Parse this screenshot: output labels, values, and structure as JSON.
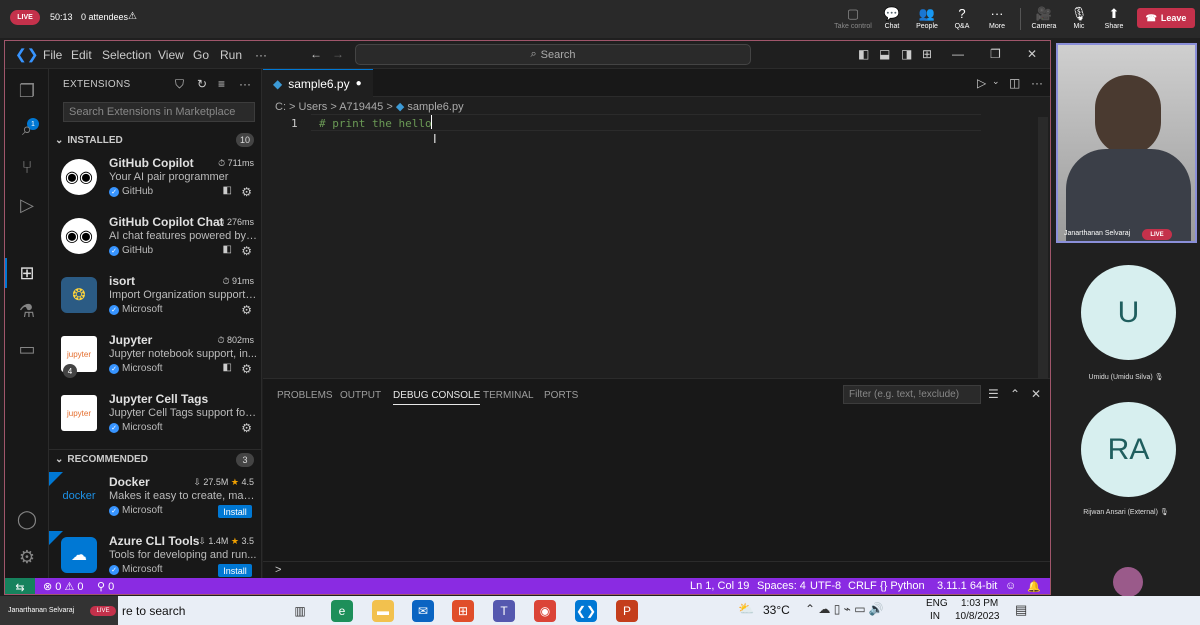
{
  "meeting": {
    "live_label": "LIVE",
    "elapsed": "50:13",
    "attendees": "0 attendees",
    "buttons": {
      "take_control": "Take control",
      "chat": "Chat",
      "people": "People",
      "qa": "Q&A",
      "more": "More",
      "camera": "Camera",
      "mic": "Mic",
      "share": "Share",
      "leave": "Leave"
    }
  },
  "vscode": {
    "menu": [
      "File",
      "Edit",
      "Selection",
      "View",
      "Go",
      "Run"
    ],
    "search_label": "Search",
    "sidebar": {
      "title": "EXTENSIONS",
      "search_placeholder": "Search Extensions in Marketplace",
      "installed": {
        "label": "INSTALLED",
        "count": "10",
        "items": [
          {
            "name": "GitHub Copilot",
            "stat": "711ms",
            "desc": "Your AI pair programmer",
            "publisher": "GitHub"
          },
          {
            "name": "GitHub Copilot Chat",
            "stat": "276ms",
            "desc": "AI chat features powered by ...",
            "publisher": "GitHub"
          },
          {
            "name": "isort",
            "stat": "91ms",
            "desc": "Import Organization support ...",
            "publisher": "Microsoft"
          },
          {
            "name": "Jupyter",
            "stat": "802ms",
            "desc": "Jupyter notebook support, in...",
            "publisher": "Microsoft",
            "badge": "4"
          },
          {
            "name": "Jupyter Cell Tags",
            "stat": "",
            "desc": "Jupyter Cell Tags support for ...",
            "publisher": "Microsoft"
          }
        ]
      },
      "recommended": {
        "label": "RECOMMENDED",
        "count": "3",
        "items": [
          {
            "name": "Docker",
            "downloads": "27.5M",
            "rating": "4.5",
            "desc": "Makes it easy to create, mana...",
            "publisher": "Microsoft",
            "action": "Install"
          },
          {
            "name": "Azure CLI Tools",
            "downloads": "1.4M",
            "rating": "3.5",
            "desc": "Tools for developing and run...",
            "publisher": "Microsoft",
            "action": "Install"
          }
        ]
      }
    },
    "editor": {
      "tab": "sample6.py",
      "breadcrumb": [
        "C:",
        "Users",
        "A719445",
        "sample6.py"
      ],
      "line_number": "1",
      "code": "# print the hello"
    },
    "panel": {
      "tabs": [
        "PROBLEMS",
        "OUTPUT",
        "DEBUG CONSOLE",
        "TERMINAL",
        "PORTS"
      ],
      "active_tab": "DEBUG CONSOLE",
      "filter_placeholder": "Filter (e.g. text, !exclude)",
      "prompt": ">"
    },
    "status": {
      "errors": "0",
      "warnings": "0",
      "ports": "0",
      "position": "Ln 1, Col 19",
      "spaces": "Spaces: 4",
      "encoding": "UTF-8",
      "eol": "CRLF",
      "language": "Python",
      "interpreter": "3.11.1 64-bit"
    }
  },
  "participants": {
    "presenter": {
      "name": "Janarthanan Selvaraj",
      "badge": "LIVE"
    },
    "others": [
      {
        "initials": "U",
        "name": "Umidu (Umidu Silva)"
      },
      {
        "initials": "RA",
        "name": "Rijwan Ansari (External)"
      }
    ]
  },
  "taskbar": {
    "presenter_overlay": "Janarthanan Selvaraj",
    "overlay_badge": "LIVE",
    "search_text": "re to search",
    "temperature": "33°C",
    "language": "ENG",
    "region": "IN",
    "time": "1:03 PM",
    "date": "10/8/2023"
  },
  "colors": {
    "accent": "#0078d4",
    "statusbar": "#8a2be2",
    "live": "#c4314b"
  }
}
